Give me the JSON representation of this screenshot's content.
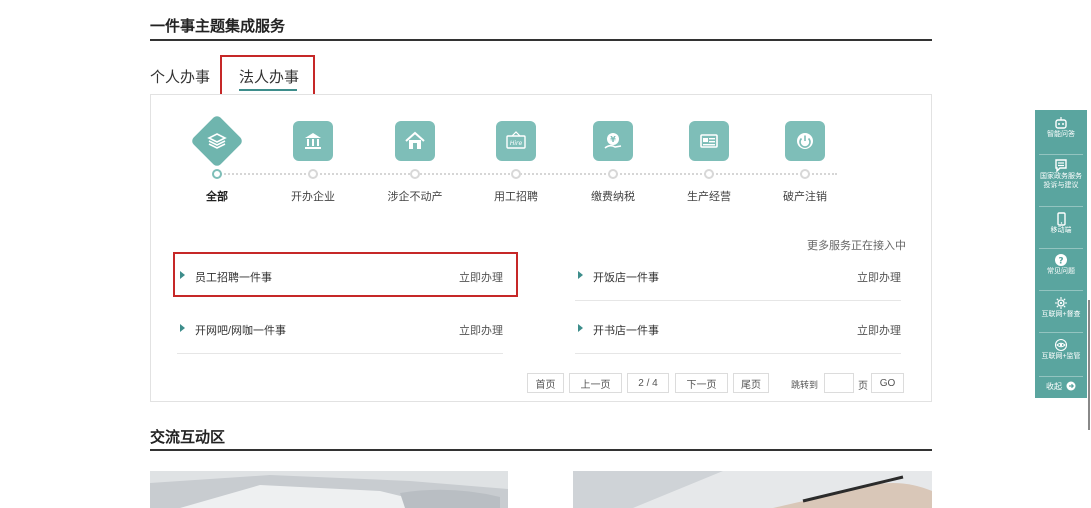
{
  "section1": {
    "title": "一件事主题集成服务"
  },
  "tabs": [
    {
      "label": "个人办事",
      "active": false
    },
    {
      "label": "法人办事",
      "active": true
    }
  ],
  "categories": [
    {
      "label": "全部",
      "icon": "layers-icon",
      "active": true
    },
    {
      "label": "开办企业",
      "icon": "bank-icon",
      "active": false
    },
    {
      "label": "涉企不动产",
      "icon": "house-icon",
      "active": false
    },
    {
      "label": "用工招聘",
      "icon": "hire-sign-icon",
      "active": false
    },
    {
      "label": "缴费纳税",
      "icon": "yuan-hand-icon",
      "active": false
    },
    {
      "label": "生产经营",
      "icon": "document-icon",
      "active": false
    },
    {
      "label": "破产注销",
      "icon": "power-icon",
      "active": false
    }
  ],
  "more_services_note": "更多服务正在接入中",
  "services": [
    {
      "name": "员工招聘一件事",
      "action": "立即办理"
    },
    {
      "name": "开饭店一件事",
      "action": "立即办理"
    },
    {
      "name": "开网吧/网咖一件事",
      "action": "立即办理"
    },
    {
      "name": "开书店一件事",
      "action": "立即办理"
    }
  ],
  "pagination": {
    "first": "首页",
    "prev": "上一页",
    "current": "2 / 4",
    "next": "下一页",
    "last": "尾页",
    "jump_label": "跳转到",
    "page_unit": "页",
    "go": "GO"
  },
  "section2": {
    "title": "交流互动区"
  },
  "sidebar": {
    "items": [
      {
        "label": "智能问答",
        "icon": "robot-icon"
      },
      {
        "label": "国家政务服务\n投诉与建议",
        "icon": "message-icon"
      },
      {
        "label": "移动端",
        "icon": "mobile-icon"
      },
      {
        "label": "常见问题",
        "icon": "question-icon"
      },
      {
        "label": "互联网+督查",
        "icon": "settings-eye-icon"
      },
      {
        "label": "互联网+监管",
        "icon": "eye-icon"
      }
    ],
    "collapse_label": "收起"
  },
  "colors": {
    "accent": "#7ebeb8",
    "accent_dark": "#3d8d8b",
    "sidebar": "#5aa59f",
    "highlight": "#c62828"
  }
}
